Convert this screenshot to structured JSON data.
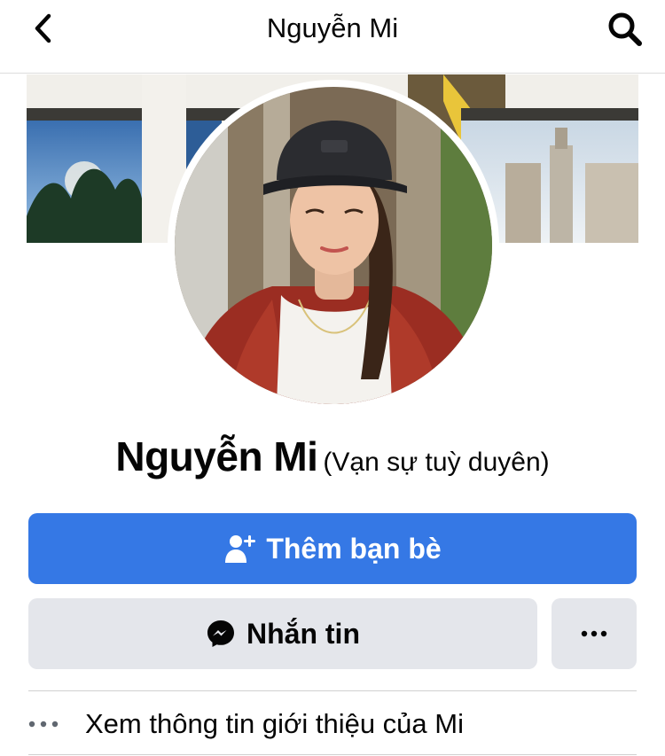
{
  "header": {
    "title": "Nguyễn Mi",
    "back_icon": "chevron-left-icon",
    "search_icon": "search-icon"
  },
  "profile": {
    "name": "Nguyễn Mi",
    "alternate_name": "(Vạn sự tuỳ duyên)"
  },
  "actions": {
    "add_friend_label": "Thêm bạn bè",
    "add_friend_icon": "person-add-icon",
    "message_label": "Nhắn tin",
    "message_icon": "messenger-icon",
    "more_icon": "more-horizontal-icon"
  },
  "about": {
    "label": "Xem thông tin giới thiệu của Mi",
    "icon": "more-horizontal-icon"
  },
  "colors": {
    "primary_button": "#3578e5",
    "secondary_button": "#e4e6eb",
    "text": "#050505"
  }
}
